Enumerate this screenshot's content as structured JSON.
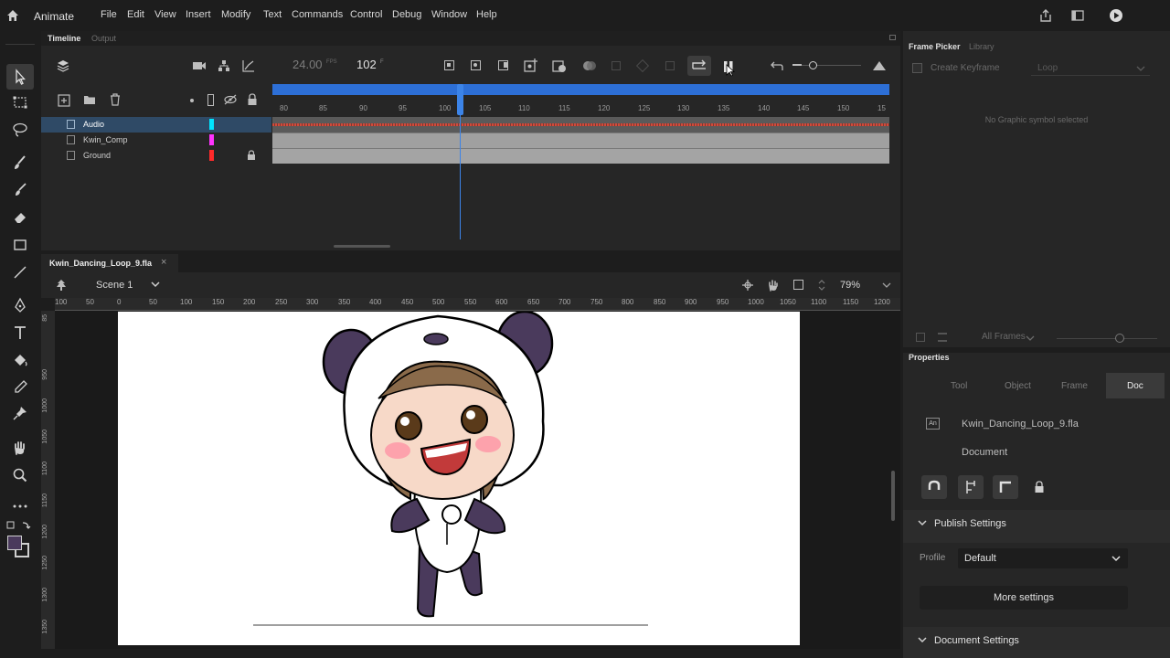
{
  "app": {
    "name": "Animate"
  },
  "menu": [
    "File",
    "Edit",
    "View",
    "Insert",
    "Modify",
    "Text",
    "Commands",
    "Control",
    "Debug",
    "Window",
    "Help"
  ],
  "timeline": {
    "tabs": [
      "Timeline",
      "Output"
    ],
    "fps": "24.00",
    "fps_unit": "FPS",
    "frame": "102",
    "frame_unit": "F",
    "layers": [
      {
        "name": "Audio",
        "color": "#00e5ff"
      },
      {
        "name": "Kwin_Comp",
        "color": "#ff33ff"
      },
      {
        "name": "Ground",
        "color": "#ff2a2a"
      }
    ],
    "ruler": [
      "80",
      "85",
      "90",
      "95",
      "100",
      "105",
      "110",
      "115",
      "120",
      "125",
      "130",
      "135",
      "140",
      "145",
      "150",
      "15"
    ]
  },
  "document": {
    "tab": "Kwin_Dancing_Loop_9.fla",
    "scene": "Scene 1",
    "zoom": "79%",
    "ruler_top": [
      "100",
      "50",
      "0",
      "50",
      "100",
      "150",
      "200",
      "250",
      "300",
      "350",
      "400",
      "450",
      "500",
      "550",
      "600",
      "650",
      "700",
      "750",
      "800",
      "850",
      "900",
      "950",
      "1000",
      "1050",
      "1100",
      "1150",
      "1200"
    ],
    "ruler_left": [
      "85",
      "950",
      "1000",
      "1050",
      "1100",
      "1150",
      "1200",
      "1250",
      "1300",
      "1350"
    ]
  },
  "frame_picker": {
    "tabs": [
      "Frame Picker",
      "Library"
    ],
    "create_keyframe": "Create Keyframe",
    "loop": "Loop",
    "empty_msg": "No Graphic symbol selected",
    "all_frames": "All Frames"
  },
  "properties": {
    "title": "Properties",
    "tabs": [
      "Tool",
      "Object",
      "Frame",
      "Doc"
    ],
    "file": "Kwin_Dancing_Loop_9.fla",
    "kind": "Document",
    "publish_settings": "Publish Settings",
    "profile_label": "Profile",
    "profile_value": "Default",
    "more_settings": "More settings",
    "document_settings": "Document Settings"
  }
}
